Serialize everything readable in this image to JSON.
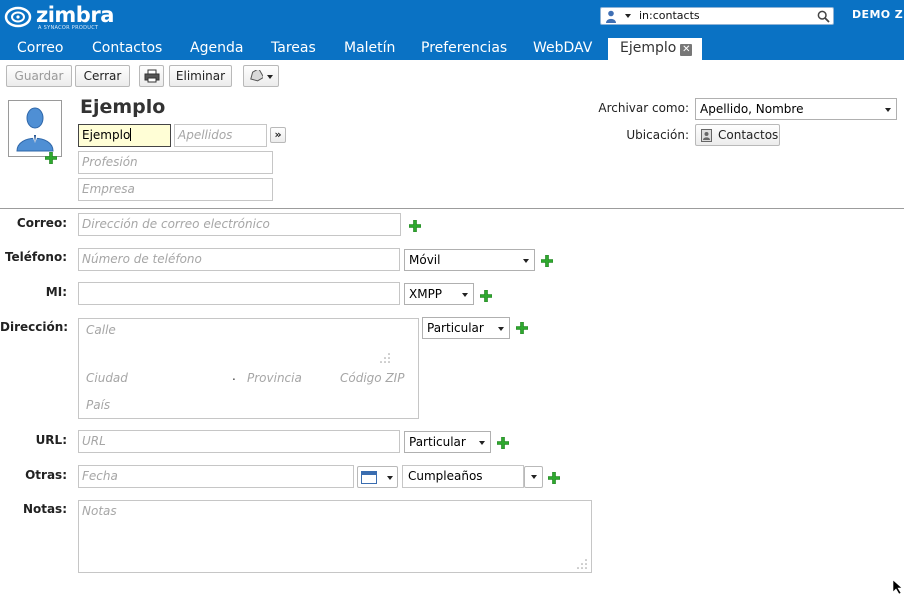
{
  "app": {
    "logo_text": "zimbra",
    "logo_tagline": "A SYNACOR PRODUCT",
    "search_value": "in:contacts",
    "username": "DEMO ZI"
  },
  "tabs": [
    {
      "label": "Correo"
    },
    {
      "label": "Contactos"
    },
    {
      "label": "Agenda"
    },
    {
      "label": "Tareas"
    },
    {
      "label": "Maletín"
    },
    {
      "label": "Preferencias"
    },
    {
      "label": "WebDAV"
    },
    {
      "label": "Ejemplo",
      "active": true
    }
  ],
  "toolbar": {
    "save_label": "Guardar",
    "close_label": "Cerrar",
    "delete_label": "Eliminar"
  },
  "contact": {
    "title": "Ejemplo",
    "first_name_value": "Ejemplo",
    "last_name_placeholder": "Apellidos",
    "expand_label": "»",
    "job_placeholder": "Profesión",
    "company_placeholder": "Empresa",
    "file_as_label": "Archivar como:",
    "file_as_value": "Apellido, Nombre",
    "location_label": "Ubicación:",
    "location_value": "Contactos"
  },
  "form": {
    "email": {
      "label": "Correo:",
      "placeholder": "Dirección de correo electrónico"
    },
    "phone": {
      "label": "Teléfono:",
      "placeholder": "Número de teléfono",
      "type": "Móvil"
    },
    "im": {
      "label": "MI:",
      "value": "",
      "type": "XMPP"
    },
    "address": {
      "label": "Dirección:",
      "street_placeholder": "Calle",
      "city_placeholder": "Ciudad",
      "separator": ".",
      "state_placeholder": "Provincia",
      "zip_placeholder": "Código ZIP",
      "country_placeholder": "País",
      "type": "Particular"
    },
    "url": {
      "label": "URL:",
      "placeholder": "URL",
      "type": "Particular"
    },
    "other": {
      "label": "Otras:",
      "placeholder": "Fecha",
      "type": "Cumpleaños"
    },
    "notes": {
      "label": "Notas:",
      "placeholder": "Notas"
    }
  },
  "colors": {
    "header_blue": "#0a72c4",
    "plus_green": "#2ea82e",
    "focus_yellow": "#fffed6"
  }
}
